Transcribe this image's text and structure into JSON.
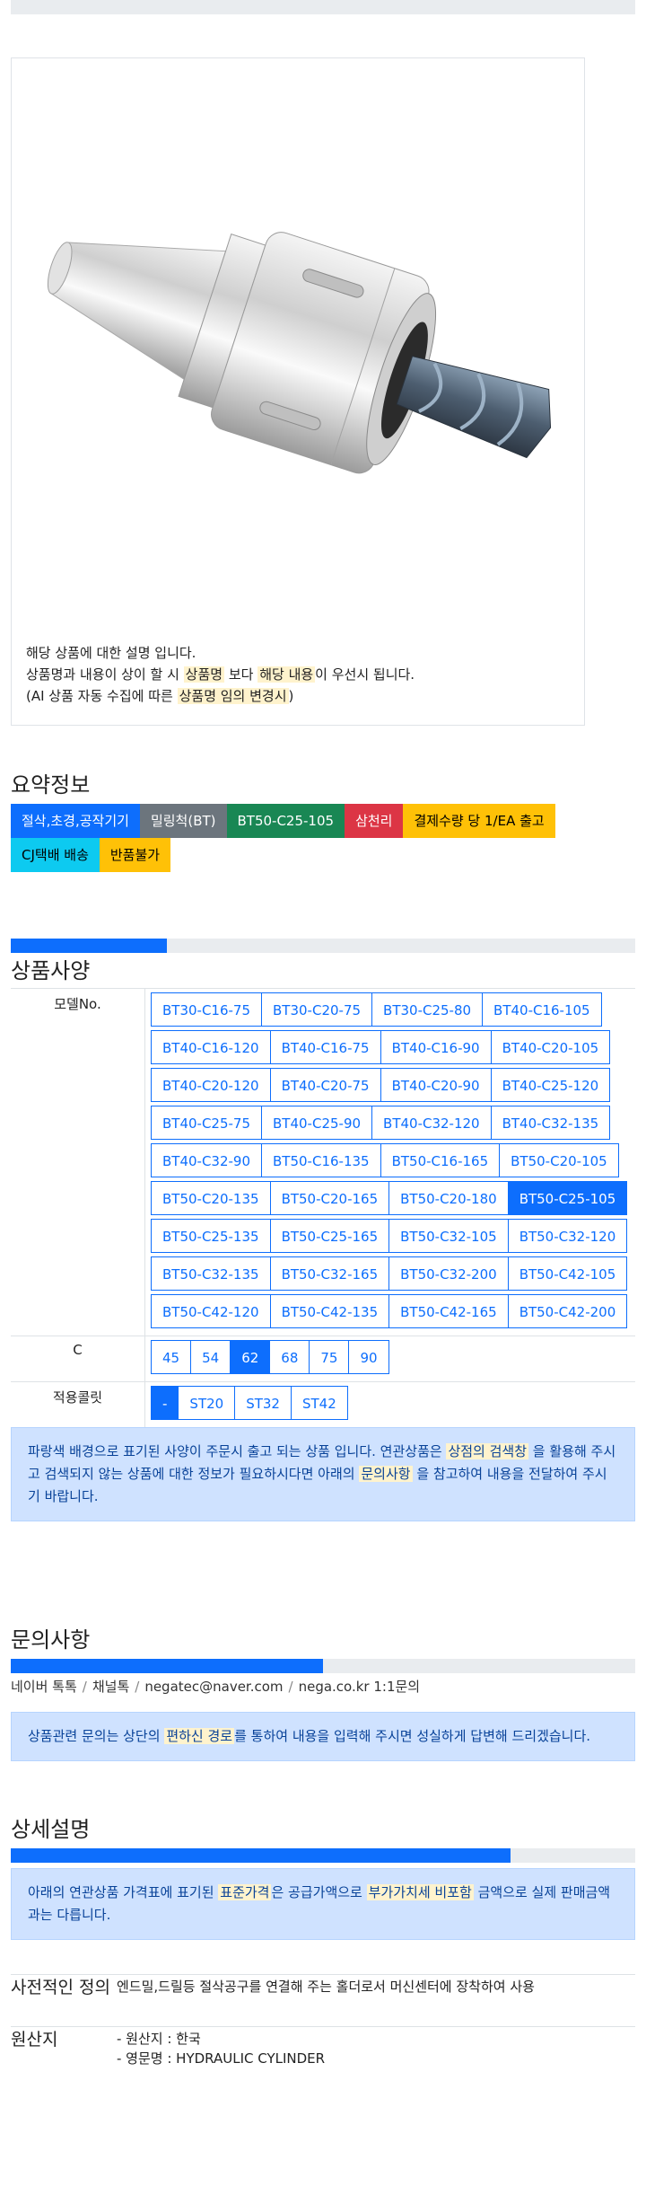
{
  "product_image": {
    "desc_line1": "해당 상품에 대한 설명 입니다.",
    "desc_line2_a": "상품명과 내용이 상이 할 시 ",
    "desc_line2_hl1": "상품명",
    "desc_line2_b": " 보다 ",
    "desc_line2_hl2": "해당 내용",
    "desc_line2_c": "이 우선시 됩니다.",
    "desc_line3_a": "(AI 상품 자동 수집에 따른 ",
    "desc_line3_hl": "상품명 임의 변경시",
    "desc_line3_b": ")"
  },
  "summary": {
    "title": "요약정보",
    "badges": [
      {
        "label": "절삭,초경,공작기기",
        "color": "#0d6efd",
        "text": "#ffffff"
      },
      {
        "label": "밀링척(BT)",
        "color": "#6c757d",
        "text": "#ffffff"
      },
      {
        "label": "BT50-C25-105",
        "color": "#198754",
        "text": "#ffffff"
      },
      {
        "label": "삼천리",
        "color": "#dc3545",
        "text": "#ffffff"
      },
      {
        "label": "결제수량 당 1/EA 출고",
        "color": "#ffc107",
        "text": "#000000"
      },
      {
        "label": "CJ택배 배송",
        "color": "#0dcaf0",
        "text": "#000000"
      },
      {
        "label": "반품불가",
        "color": "#ffc107",
        "text": "#000000"
      }
    ]
  },
  "spec": {
    "title": "상품사양",
    "progress": 0.25,
    "model_label": "모델No.",
    "models": [
      "BT30-C16-75",
      "BT30-C20-75",
      "BT30-C25-80",
      "BT40-C16-105",
      "BT40-C16-120",
      "BT40-C16-75",
      "BT40-C16-90",
      "BT40-C20-105",
      "BT40-C20-120",
      "BT40-C20-75",
      "BT40-C20-90",
      "BT40-C25-120",
      "BT40-C25-75",
      "BT40-C25-90",
      "BT40-C32-120",
      "BT40-C32-135",
      "BT40-C32-90",
      "BT50-C16-135",
      "BT50-C16-165",
      "BT50-C20-105",
      "BT50-C20-135",
      "BT50-C20-165",
      "BT50-C20-180",
      "BT50-C25-105",
      "BT50-C25-135",
      "BT50-C25-165",
      "BT50-C32-105",
      "BT50-C32-120",
      "BT50-C32-135",
      "BT50-C32-165",
      "BT50-C32-200",
      "BT50-C42-105",
      "BT50-C42-120",
      "BT50-C42-135",
      "BT50-C42-165",
      "BT50-C42-200"
    ],
    "model_selected": "BT50-C25-105",
    "c_label": "C",
    "c_options": [
      "45",
      "54",
      "62",
      "68",
      "75",
      "90"
    ],
    "c_selected": "62",
    "collet_label": "적용콜릿",
    "collet_options": [
      "-",
      "ST20",
      "ST32",
      "ST42"
    ],
    "collet_selected": "-",
    "notice_a": "파랑색 배경으로 표기된 사양이 주문시 출고 되는 상품 입니다. 연관상품은 ",
    "notice_hl1": "상점의 검색창",
    "notice_b": " 을 활용해 주시고 검색되지 않는 상품에 대한 정보가 필요하시다면 아래의 ",
    "notice_hl2": "문의사항",
    "notice_c": " 을 참고하여 내용을 전달하여 주시기 바랍니다."
  },
  "inquiry": {
    "title": "문의사항",
    "progress": 0.5,
    "links": [
      "네이버 톡톡",
      "채널톡",
      "negatec@naver.com",
      "nega.co.kr 1:1문의"
    ],
    "sep": "/",
    "notice_a": "상품관련 문의는 상단의 ",
    "notice_hl": "편하신 경로",
    "notice_b": "를 통하여 내용을 입력해 주시면 성실하게 답변해 드리겠습니다."
  },
  "detail": {
    "title": "상세설명",
    "progress": 0.8,
    "notice_a": "아래의 연관상품 가격표에 표기된 ",
    "notice_hl1": "표준가격",
    "notice_b": "은 공급가액으로 ",
    "notice_hl2": "부가가치세 비포함",
    "notice_c": " 금액으로 실제 판매금액과는 다릅니다.",
    "rows": [
      {
        "label": "사전적인 정의",
        "value_lines": [
          "엔드밀,드릴등 절삭공구를 연결해 주는 홀더로서 머신센터에 장착하여 사용"
        ]
      },
      {
        "label": "원산지",
        "value_lines": [
          "- 원산지 : 한국",
          "- 영문명 : HYDRAULIC CYLINDER"
        ]
      }
    ]
  }
}
